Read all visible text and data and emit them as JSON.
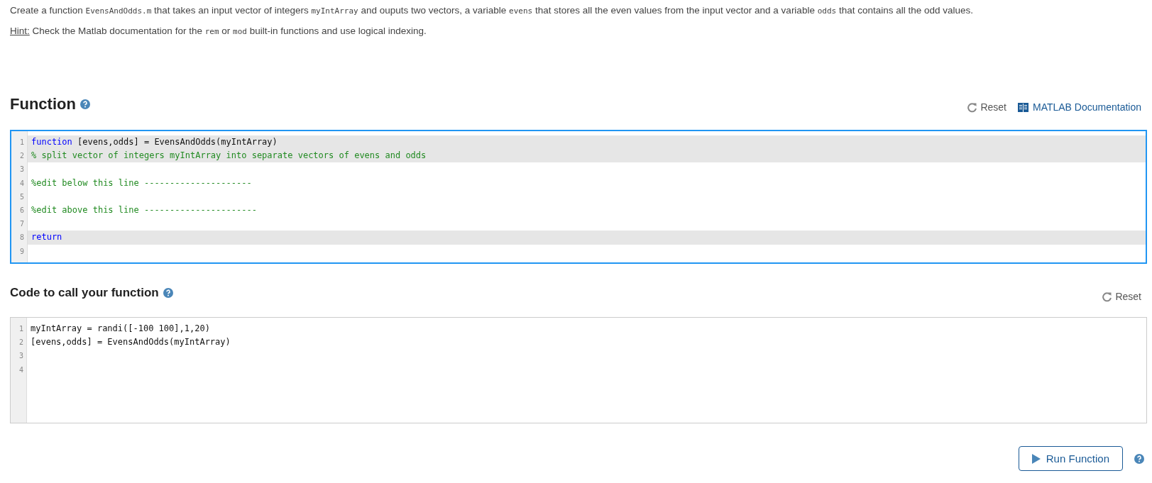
{
  "description": [
    {
      "kind": "text",
      "text": "Create a function "
    },
    {
      "kind": "code",
      "text": "EvensAndOdds.m"
    },
    {
      "kind": "text",
      "text": " that takes an input vector of integers "
    },
    {
      "kind": "code",
      "text": "myIntArray"
    },
    {
      "kind": "text",
      "text": " and ouputs two vectors, a variable "
    },
    {
      "kind": "code",
      "text": "evens"
    },
    {
      "kind": "text",
      "text": " that stores all the even values from the input vector and a variable "
    },
    {
      "kind": "code",
      "text": "odds"
    },
    {
      "kind": "text",
      "text": " that contains all the odd values."
    }
  ],
  "hint": [
    {
      "kind": "label",
      "text": "Hint:"
    },
    {
      "kind": "text",
      "text": " Check the Matlab documentation for the "
    },
    {
      "kind": "code",
      "text": "rem"
    },
    {
      "kind": "text",
      "text": " or "
    },
    {
      "kind": "code",
      "text": "mod"
    },
    {
      "kind": "text",
      "text": " built-in functions and use logical indexing."
    }
  ],
  "function_section": {
    "title": "Function",
    "reset": "Reset",
    "doc_link": "MATLAB Documentation",
    "focused": true,
    "lines": [
      {
        "number": "1",
        "locked": true,
        "tokens": [
          {
            "kind": "keyword",
            "text": "function"
          },
          {
            "kind": "plain",
            "text": " [evens,odds] = EvensAndOdds(myIntArray)"
          }
        ]
      },
      {
        "number": "2",
        "locked": true,
        "tokens": [
          {
            "kind": "comment",
            "text": "% split vector of integers myIntArray into separate vectors of evens and odds"
          }
        ]
      },
      {
        "number": "3",
        "locked": false
      },
      {
        "number": "4",
        "locked": false,
        "tokens": [
          {
            "kind": "comment",
            "text": "%edit below this line ---------------------"
          }
        ]
      },
      {
        "number": "5",
        "locked": false
      },
      {
        "number": "6",
        "locked": false,
        "tokens": [
          {
            "kind": "comment",
            "text": "%edit above this line ----------------------"
          }
        ]
      },
      {
        "number": "7",
        "locked": false
      },
      {
        "number": "8",
        "locked": true,
        "tokens": [
          {
            "kind": "keyword",
            "text": "return"
          }
        ]
      },
      {
        "number": "9",
        "locked": false
      }
    ]
  },
  "call_section": {
    "title": "Code to call your function",
    "reset": "Reset",
    "focused": false,
    "lines": [
      {
        "number": "1",
        "locked": false,
        "tokens": [
          {
            "kind": "plain",
            "text": "myIntArray = randi([-100 100],1,20)"
          }
        ]
      },
      {
        "number": "2",
        "locked": false,
        "tokens": [
          {
            "kind": "plain",
            "text": "[evens,odds] = EvensAndOdds(myIntArray)"
          }
        ]
      },
      {
        "number": "3",
        "locked": false
      },
      {
        "number": "4",
        "locked": false
      }
    ]
  },
  "run_button": "Run Function"
}
